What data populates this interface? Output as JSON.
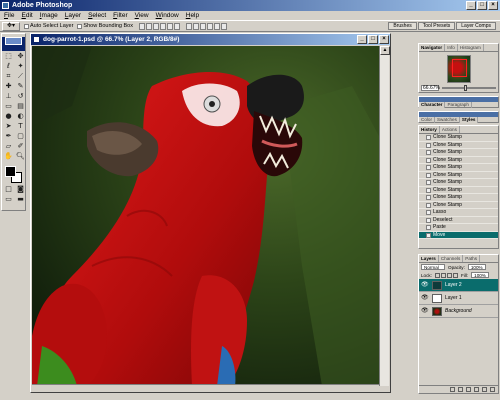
{
  "app": {
    "title": "Adobe Photoshop"
  },
  "menu": [
    "File",
    "Edit",
    "Image",
    "Layer",
    "Select",
    "Filter",
    "View",
    "Window",
    "Help"
  ],
  "options_bar": {
    "tool_icon": "move-tool-icon",
    "auto_select_layer": {
      "label": "Auto Select Layer",
      "checked": false
    },
    "show_bounding_box": {
      "label": "Show Bounding Box",
      "checked": false
    },
    "palette_well": [
      "Brushes",
      "Tool Presets",
      "Layer Comps"
    ]
  },
  "document": {
    "title": "dog-parrot-1.psd @ 66.7% (Layer 2, RGB/8#)",
    "zoom": "66.7%"
  },
  "colors": {
    "foreground": "#000000",
    "background": "#ffffff",
    "selection": "#0a6c6c",
    "titlebar": "#0a246a"
  },
  "navigator": {
    "tabs": [
      "Navigator",
      "Info",
      "Histogram"
    ],
    "zoom": "66.67%"
  },
  "character_panel": {
    "tabs": [
      "Character",
      "Paragraph"
    ]
  },
  "color_panel": {
    "tabs": [
      "Color",
      "Swatches",
      "Styles"
    ]
  },
  "history": {
    "tabs": [
      "History",
      "Actions"
    ],
    "items": [
      "Clone Stamp",
      "Clone Stamp",
      "Clone Stamp",
      "Clone Stamp",
      "Clone Stamp",
      "Clone Stamp",
      "Clone Stamp",
      "Clone Stamp",
      "Clone Stamp",
      "Clone Stamp",
      "Lasso",
      "Deselect",
      "Paste",
      "Move"
    ],
    "active_index": 13
  },
  "layers": {
    "tabs": [
      "Layers",
      "Channels",
      "Paths"
    ],
    "blend_mode": "Normal",
    "opacity_label": "Opacity:",
    "opacity": "100%",
    "lock_label": "Lock:",
    "fill_label": "Fill:",
    "fill": "100%",
    "items": [
      {
        "name": "Layer 2",
        "active": true
      },
      {
        "name": "Layer 1",
        "active": false
      },
      {
        "name": "Background",
        "active": false,
        "italic": true
      }
    ]
  }
}
